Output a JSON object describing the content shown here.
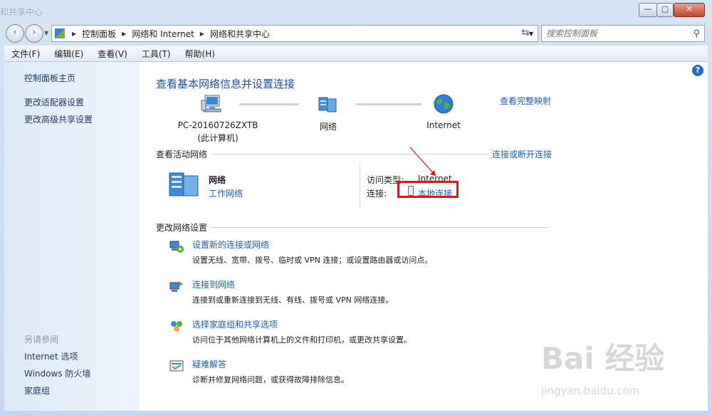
{
  "window": {
    "ghost_title": "和共享中心",
    "minimize": "—",
    "maximize": "▢",
    "close": "✕"
  },
  "nav": {
    "back": "‹",
    "forward": "›",
    "breadcrumb": [
      "控制面板",
      "网络和 Internet",
      "网络和共享中心"
    ],
    "search_placeholder": "搜索控制面板"
  },
  "menu": [
    "文件(F)",
    "编辑(E)",
    "查看(V)",
    "工具(T)",
    "帮助(H)"
  ],
  "sidebar": {
    "top_links": [
      "控制面板主页",
      "更改适配器设置",
      "更改高级共享设置"
    ],
    "see_also_heading": "另请参阅",
    "bottom_links": [
      "Internet 选项",
      "Windows 防火墙",
      "家庭组"
    ]
  },
  "main": {
    "title": "查看基本网络信息并设置连接",
    "full_map": "查看完整映射",
    "nodes": {
      "computer_line1": "PC-20160726ZXTB",
      "computer_line2": "(此计算机)",
      "network": "网络",
      "internet": "Internet"
    },
    "active": {
      "heading": "查看活动网络",
      "connect_link": "连接或断开连接",
      "network_name": "网络",
      "network_type": "工作网络",
      "access_label": "访问类型:",
      "access_value": "Internet",
      "conn_label": "连接:",
      "conn_value": "本地连接"
    },
    "change": {
      "heading": "更改网络设置",
      "items": [
        {
          "title": "设置新的连接或网络",
          "desc": "设置无线、宽带、拨号、临时或 VPN 连接；或设置路由器或访问点。",
          "icon": "network-setup-icon"
        },
        {
          "title": "连接到网络",
          "desc": "连接到或重新连接到无线、有线、拨号或 VPN 网络连接。",
          "icon": "connect-network-icon"
        },
        {
          "title": "选择家庭组和共享选项",
          "desc": "访问位于其他网络计算机上的文件和打印机，或更改共享设置。",
          "icon": "homegroup-icon"
        },
        {
          "title": "疑难解答",
          "desc": "诊断并修复网络问题，或获得故障排除信息。",
          "icon": "troubleshoot-icon"
        }
      ]
    }
  },
  "watermark": {
    "brand": "Bai 经验",
    "url": "jingyan.baidu.com"
  }
}
